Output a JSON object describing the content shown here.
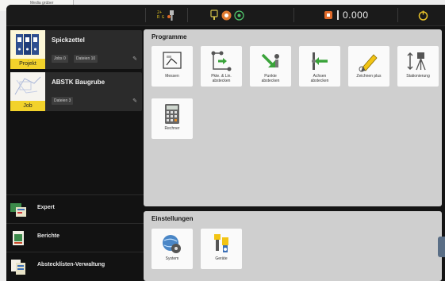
{
  "backdrop": {
    "paper_label": "Media grüber"
  },
  "topbar": {
    "status_mini": "2+\nR G",
    "measure_value": "0.000"
  },
  "projects": [
    {
      "title": "Spickzettel",
      "badge": "Projekt",
      "chips": [
        "Jobs 0",
        "Dateien 10"
      ]
    },
    {
      "title": "ABSTK Baugrube",
      "badge": "Job",
      "chips": [
        "Dateien 3"
      ]
    }
  ],
  "menu": [
    {
      "label": "Expert",
      "icon": "expert-icon"
    },
    {
      "label": "Berichte",
      "icon": "reports-icon"
    },
    {
      "label": "Abstecklísten-Verwaltung",
      "icon": "list-manager-icon"
    }
  ],
  "programs": {
    "heading": "Programme",
    "tiles": [
      {
        "label": "Messen",
        "icon": "measure-icon"
      },
      {
        "label": "Pkte. & Lin.\nabstecken",
        "icon": "stakeout-points-lines-icon"
      },
      {
        "label": "Punkte\nabstecken",
        "icon": "stakeout-points-icon"
      },
      {
        "label": "Achsen\nabstecken",
        "icon": "stakeout-axis-icon"
      },
      {
        "label": "Zeichnen plus",
        "icon": "draw-plus-icon"
      },
      {
        "label": "Stationierung",
        "icon": "stationing-icon"
      },
      {
        "label": "Rechner",
        "icon": "calculator-icon"
      }
    ]
  },
  "settings": {
    "heading": "Einstellungen",
    "tiles": [
      {
        "label": "System",
        "icon": "system-icon"
      },
      {
        "label": "Geräte",
        "icon": "devices-icon"
      }
    ]
  }
}
